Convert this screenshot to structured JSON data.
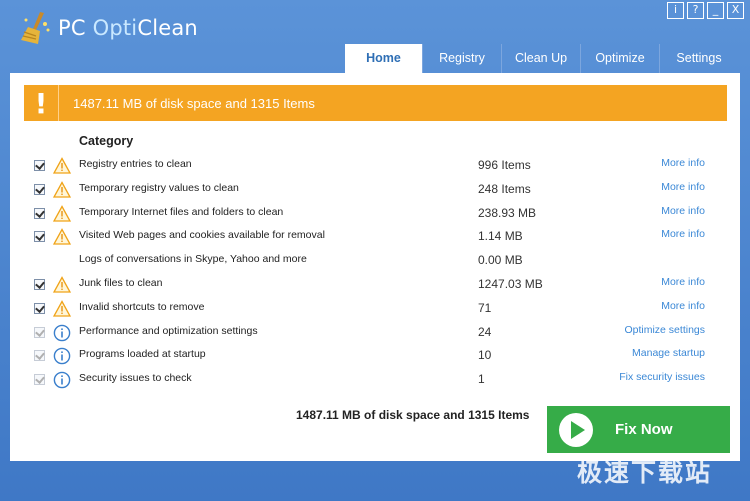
{
  "app": {
    "title_part1": "PC ",
    "title_part2": "Opti",
    "title_part3": "Clean"
  },
  "window_controls": [
    "i",
    "?",
    "_",
    "X"
  ],
  "tabs": [
    {
      "label": "Home",
      "active": true
    },
    {
      "label": "Registry",
      "active": false
    },
    {
      "label": "Clean Up",
      "active": false
    },
    {
      "label": "Optimize",
      "active": false
    },
    {
      "label": "Settings",
      "active": false
    }
  ],
  "alert": {
    "mark": "!",
    "text": "1487.11 MB of disk space and 1315 Items",
    "color": "#f4a422"
  },
  "category_header": "Category",
  "rows": [
    {
      "checked": true,
      "icon": "warning-icon",
      "label": "Registry entries to clean",
      "value": "996 Items",
      "link": "More info"
    },
    {
      "checked": true,
      "icon": "warning-icon",
      "label": "Temporary registry values to clean",
      "value": "248 Items",
      "link": "More info"
    },
    {
      "checked": true,
      "icon": "warning-icon",
      "label": "Temporary Internet files and folders to clean",
      "value": "238.93 MB",
      "link": "More info"
    },
    {
      "checked": true,
      "icon": "warning-icon",
      "label": "Visited Web pages and cookies available for removal",
      "value": "1.14 MB",
      "link": "More info"
    },
    {
      "checked": false,
      "icon": "",
      "label": "Logs of conversations in Skype, Yahoo and more",
      "value": "0.00 MB",
      "link": ""
    },
    {
      "checked": true,
      "icon": "warning-icon",
      "label": "Junk files to clean",
      "value": "1247.03 MB",
      "link": "More info"
    },
    {
      "checked": true,
      "icon": "warning-icon",
      "label": "Invalid shortcuts to remove",
      "value": "71",
      "link": "More info"
    },
    {
      "checked": true,
      "dim": true,
      "icon": "info-icon",
      "label": "Performance and optimization settings",
      "value": "24",
      "link": "Optimize settings"
    },
    {
      "checked": true,
      "dim": true,
      "icon": "info-icon",
      "label": "Programs loaded at startup",
      "value": "10",
      "link": "Manage startup"
    },
    {
      "checked": true,
      "dim": true,
      "icon": "info-icon",
      "label": "Security issues to check",
      "value": "1",
      "link": "Fix security issues"
    }
  ],
  "summary": "1487.11 MB of disk space and 1315 Items",
  "fix_button": {
    "label": "Fix Now",
    "color": "#36ac48"
  },
  "watermark": "极速下载站"
}
